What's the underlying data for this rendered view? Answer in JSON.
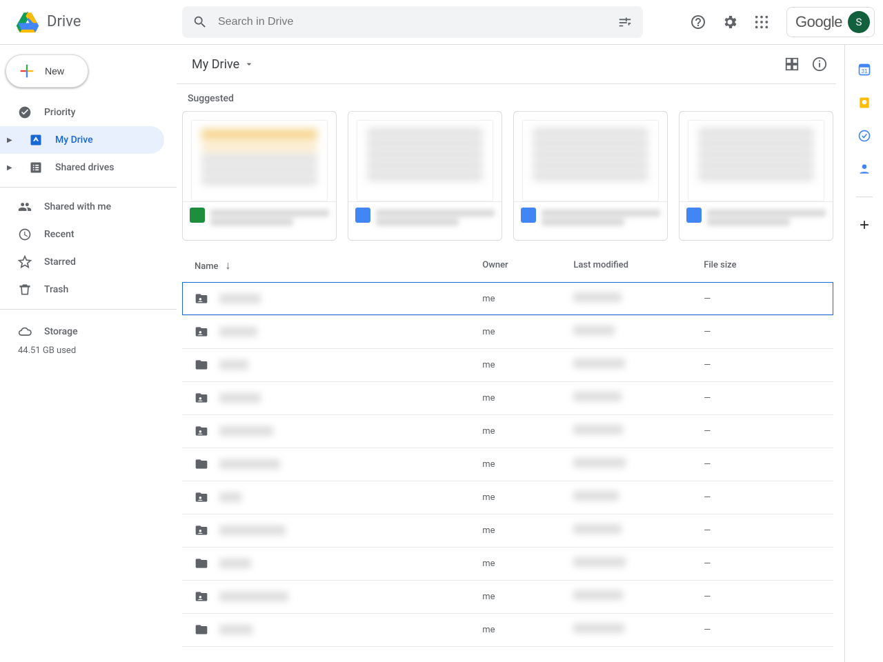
{
  "header": {
    "product": "Drive",
    "search_placeholder": "Search in Drive",
    "account_word": "Google",
    "avatar_initial": "S"
  },
  "sidebar": {
    "new_label": "New",
    "items": {
      "priority": "Priority",
      "my_drive": "My Drive",
      "shared_drives": "Shared drives",
      "shared_with_me": "Shared with me",
      "recent": "Recent",
      "starred": "Starred",
      "trash": "Trash"
    },
    "storage_label": "Storage",
    "storage_usage": "44.51 GB used"
  },
  "main": {
    "location": "My Drive",
    "suggested_label": "Suggested",
    "columns": {
      "name": "Name",
      "owner": "Owner",
      "modified": "Last modified",
      "size": "File size"
    },
    "owner_me": "me",
    "size_empty": "—",
    "rows": [
      {
        "shared": true,
        "selected": true,
        "name_w": 60,
        "mod_w": 70
      },
      {
        "shared": true,
        "selected": false,
        "name_w": 55,
        "mod_w": 60
      },
      {
        "shared": false,
        "selected": false,
        "name_w": 42,
        "mod_w": 75
      },
      {
        "shared": true,
        "selected": false,
        "name_w": 60,
        "mod_w": 70
      },
      {
        "shared": true,
        "selected": false,
        "name_w": 78,
        "mod_w": 72
      },
      {
        "shared": false,
        "selected": false,
        "name_w": 88,
        "mod_w": 76
      },
      {
        "shared": true,
        "selected": false,
        "name_w": 32,
        "mod_w": 66
      },
      {
        "shared": true,
        "selected": false,
        "name_w": 96,
        "mod_w": 70
      },
      {
        "shared": false,
        "selected": false,
        "name_w": 46,
        "mod_w": 76
      },
      {
        "shared": true,
        "selected": false,
        "name_w": 100,
        "mod_w": 72
      },
      {
        "shared": false,
        "selected": false,
        "name_w": 48,
        "mod_w": 74
      }
    ],
    "suggested_cards": [
      {
        "chip": "green"
      },
      {
        "chip": "blue"
      },
      {
        "chip": "blue"
      },
      {
        "chip": "blue"
      }
    ]
  }
}
